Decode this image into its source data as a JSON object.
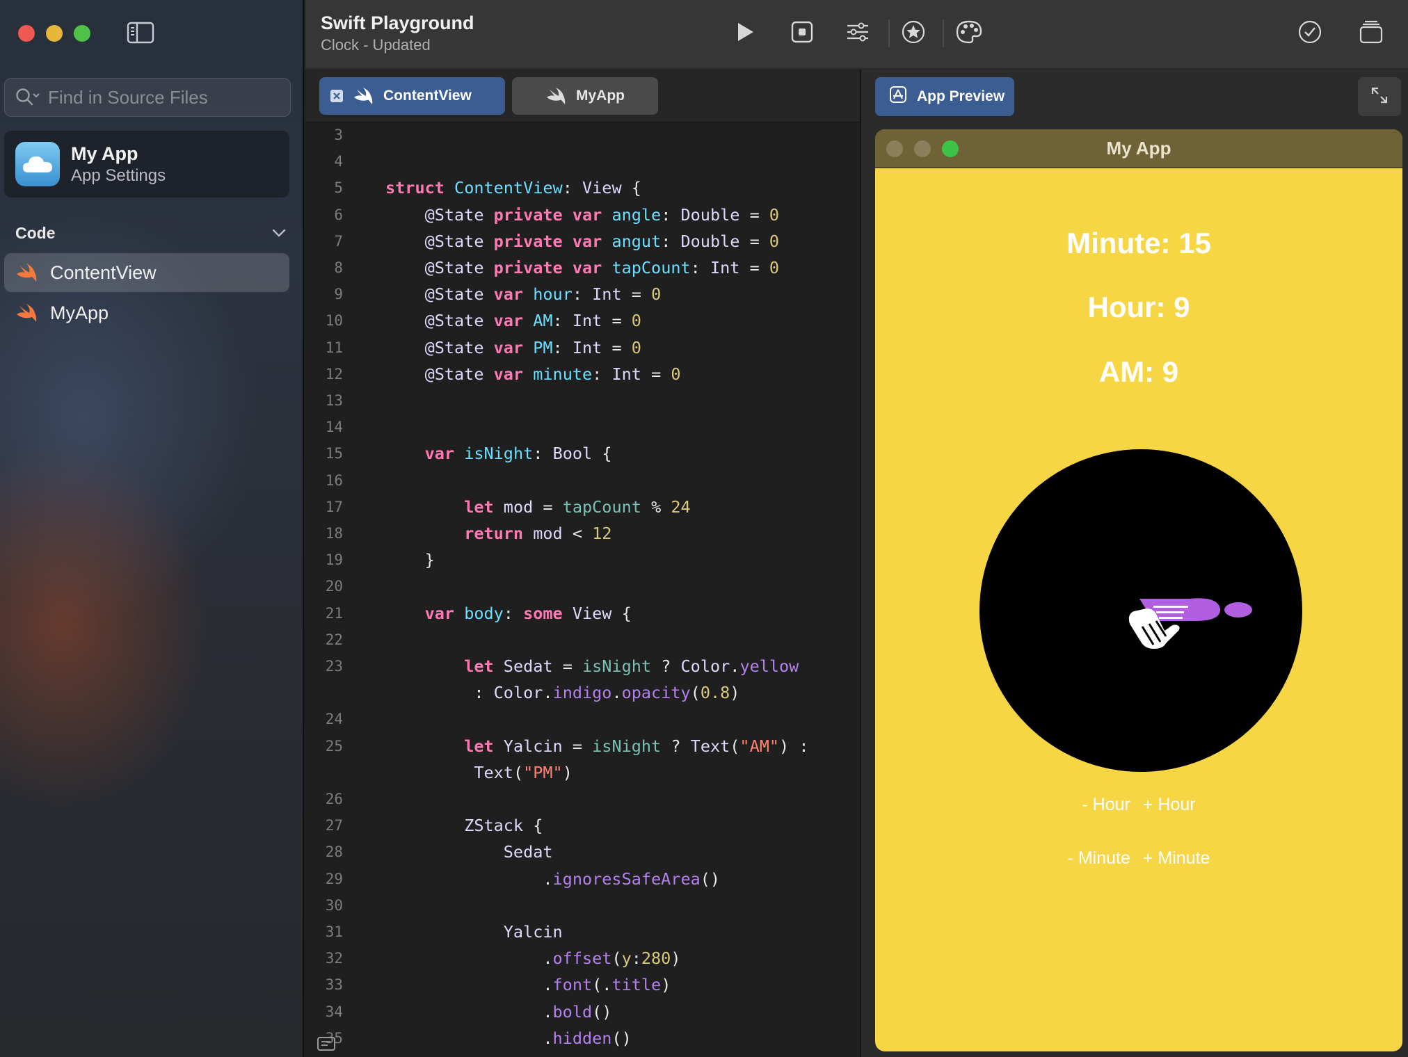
{
  "sidebar": {
    "search_placeholder": "Find in Source Files",
    "app": {
      "name": "My App",
      "subtitle": "App Settings"
    },
    "section_label": "Code",
    "files": [
      {
        "label": "ContentView",
        "selected": true
      },
      {
        "label": "MyApp",
        "selected": false
      }
    ]
  },
  "header": {
    "title": "Swift Playground",
    "subtitle": "Clock - Updated",
    "tools": [
      "play-icon",
      "stop-record-icon",
      "sliders-icon",
      "star-icon",
      "palette-icon",
      "checkmark-icon",
      "windows-icon"
    ]
  },
  "editor": {
    "tabs": [
      {
        "label": "ContentView",
        "active": true
      },
      {
        "label": "MyApp",
        "active": false
      }
    ],
    "line_numbers": [
      "3",
      "4",
      "5",
      "6",
      "7",
      "8",
      "9",
      "10",
      "11",
      "12",
      "13",
      "14",
      "15",
      "16",
      "17",
      "18",
      "19",
      "20",
      "21",
      "22",
      "23",
      "",
      "24",
      "25",
      "",
      "26",
      "27",
      "28",
      "29",
      "30",
      "31",
      "32",
      "33",
      "34",
      "35"
    ],
    "code_lines": [
      "",
      "",
      "struct ContentView: View {",
      "    @State private var angle: Double = 0",
      "    @State private var angut: Double = 0",
      "    @State private var tapCount: Int = 0",
      "    @State var hour: Int = 0",
      "    @State var AM: Int = 0",
      "    @State var PM: Int = 0",
      "    @State var minute: Int = 0",
      "",
      "",
      "    var isNight: Bool {",
      "",
      "        let mod = tapCount % 24",
      "        return mod < 12",
      "    }",
      "",
      "    var body: some View {",
      "",
      "        let Sedat = isNight ? Color.yellow",
      "         : Color.indigo.opacity(0.8)",
      "",
      "        let Yalcin = isNight ? Text(\"AM\") :",
      "         Text(\"PM\")",
      "",
      "        ZStack {",
      "            Sedat",
      "                .ignoresSafeArea()",
      "",
      "            Yalcin",
      "                .offset(y:280)",
      "                .font(.title)",
      "                .bold()",
      "                .hidden()"
    ]
  },
  "preview": {
    "tab_label": "App Preview",
    "window_title": "My App",
    "minute_text": "Minute: 15",
    "hour_text": "Hour: 9",
    "ampm_text": "AM: 9",
    "hour_controls": [
      "- Hour",
      "+ Hour"
    ],
    "minute_controls": [
      "- Minute",
      "+ Minute"
    ],
    "colors": {
      "background": "#f7d646",
      "clock_face": "#000000",
      "hand": "#b15ee0"
    }
  }
}
